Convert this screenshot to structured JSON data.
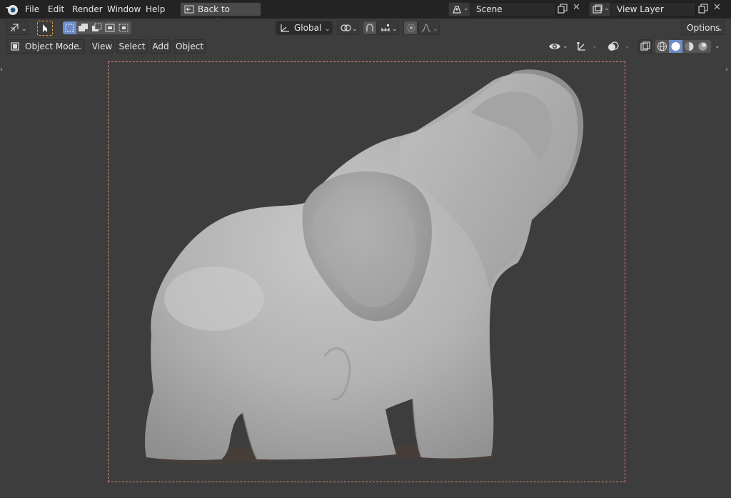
{
  "topbar": {
    "menu": [
      {
        "label": "File"
      },
      {
        "label": "Edit"
      },
      {
        "label": "Render"
      },
      {
        "label": "Window"
      },
      {
        "label": "Help"
      }
    ],
    "back_button": "Back to Previous",
    "scene_name": "Scene",
    "view_layer_name": "View Layer"
  },
  "header1": {
    "transform_orientation": "Global",
    "options_label": "Options"
  },
  "header2": {
    "mode": "Object Mode",
    "menus": [
      {
        "label": "View"
      },
      {
        "label": "Select"
      },
      {
        "label": "Add"
      },
      {
        "label": "Object"
      }
    ]
  },
  "colors": {
    "topbar_bg": "#232323",
    "header_bg": "#3d3d3d",
    "viewport_bg": "#3d3d3d",
    "accent_blue": "#6d8bc7",
    "camera_frame": "#e3857a",
    "active_tool_outline": "#e6a03a"
  },
  "icons": {
    "app_logo": "blender-logo-icon",
    "back": "back-icon",
    "scene": "scene-icon",
    "view_layer": "view-layer-icon",
    "model": "elephant-sculpt-model"
  }
}
